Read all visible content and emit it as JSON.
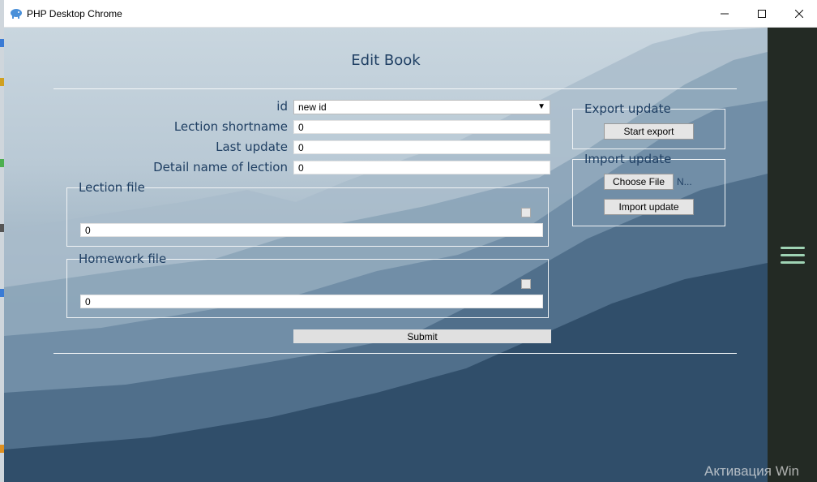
{
  "window": {
    "title": "PHP Desktop Chrome",
    "controls": {
      "minimize": "—",
      "maximize": "☐",
      "close": "✕"
    }
  },
  "page": {
    "heading": "Edit Book",
    "form": {
      "id_label": "id",
      "id_value": "new id",
      "shortname_label": "Lection shortname",
      "shortname_value": "0",
      "last_update_label": "Last update",
      "last_update_value": "0",
      "detail_label": "Detail name of lection",
      "detail_value": "0",
      "lection_file": {
        "legend": "Lection file",
        "value": "0",
        "checked": false
      },
      "homework_file": {
        "legend": "Homework file",
        "value": "0",
        "checked": false
      },
      "submit_label": "Submit"
    },
    "export": {
      "legend": "Export update",
      "button": "Start export"
    },
    "import": {
      "legend": "Import update",
      "choose_button": "Choose File",
      "no_file_text": "N...",
      "button": "Import update"
    }
  },
  "sidebar": {
    "menu_icon": "hamburger-menu-icon",
    "accent": "#9fd3b4"
  },
  "watermark": "Активация Win",
  "colors": {
    "text": "#1f3f63",
    "panel": "#232a24"
  }
}
